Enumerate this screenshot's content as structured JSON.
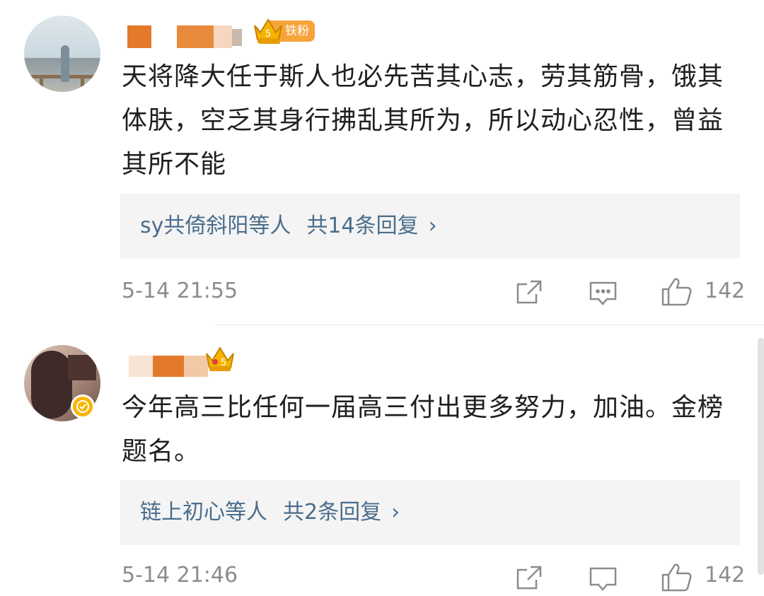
{
  "comments": [
    {
      "fan_badge": "铁粉",
      "text": "天将降大任于斯人也必先苦其心志，劳其筋骨，饿其体肤，空乏其身行拂乱其所为，所以动心忍性，曾益其所不能",
      "replies": {
        "names": "sy共倚斜阳等人",
        "count": "共14条回复",
        "chevron": "›"
      },
      "time": "5-14 21:55",
      "likes": "142",
      "icons": [
        "share-icon",
        "comment-icon",
        "like-icon"
      ]
    },
    {
      "text": "今年高三比任何一届高三付出更多努力，加油。金榜题名。",
      "replies": {
        "names": "链上初心等人",
        "count": "共2条回复",
        "chevron": "›"
      },
      "time": "5-14 21:46",
      "likes": "142",
      "verified": true,
      "icons": [
        "share-icon",
        "comment-icon",
        "like-icon"
      ]
    }
  ],
  "colors": {
    "link": "#4a6d8c",
    "meta": "#8c8c8c",
    "badge": "#f6a33a",
    "verified": "#f7b500",
    "reply_bg": "#f4f4f4"
  }
}
